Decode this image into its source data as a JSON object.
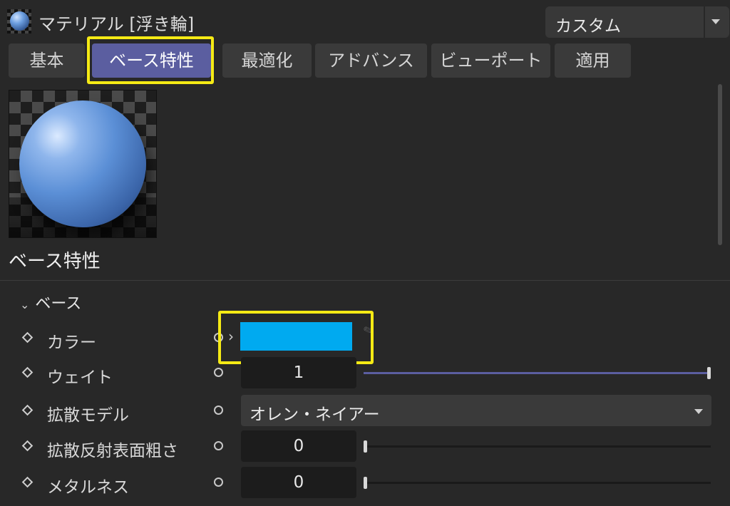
{
  "header": {
    "title": "マテリアル [浮き輪]",
    "icon": "material-sphere-icon",
    "preset": {
      "value": "カスタム"
    }
  },
  "tabs": [
    {
      "label": "基本",
      "active": false
    },
    {
      "label": "ベース特性",
      "active": true
    },
    {
      "label": "最適化",
      "active": false
    },
    {
      "label": "アドバンス",
      "active": false
    },
    {
      "label": "ビューポート",
      "active": false
    },
    {
      "label": "適用",
      "active": false
    }
  ],
  "section": {
    "title": "ベース特性"
  },
  "group": {
    "label": "ベース",
    "expanded": true
  },
  "properties": {
    "color": {
      "label": "カラー",
      "value_hex": "#00aaf0"
    },
    "weight": {
      "label": "ウェイト",
      "value": "1",
      "fraction": 1.0
    },
    "diffuse_model": {
      "label": "拡散モデル",
      "value": "オレン・ネイアー"
    },
    "diffuse_roughness": {
      "label": "拡散反射表面粗さ",
      "value": "0",
      "fraction": 0.0
    },
    "metalness": {
      "label": "メタルネス",
      "value": "0",
      "fraction": 0.0
    }
  },
  "colors": {
    "accent": "#5b5ea0",
    "highlight": "#f5ea15",
    "background": "#282828"
  }
}
